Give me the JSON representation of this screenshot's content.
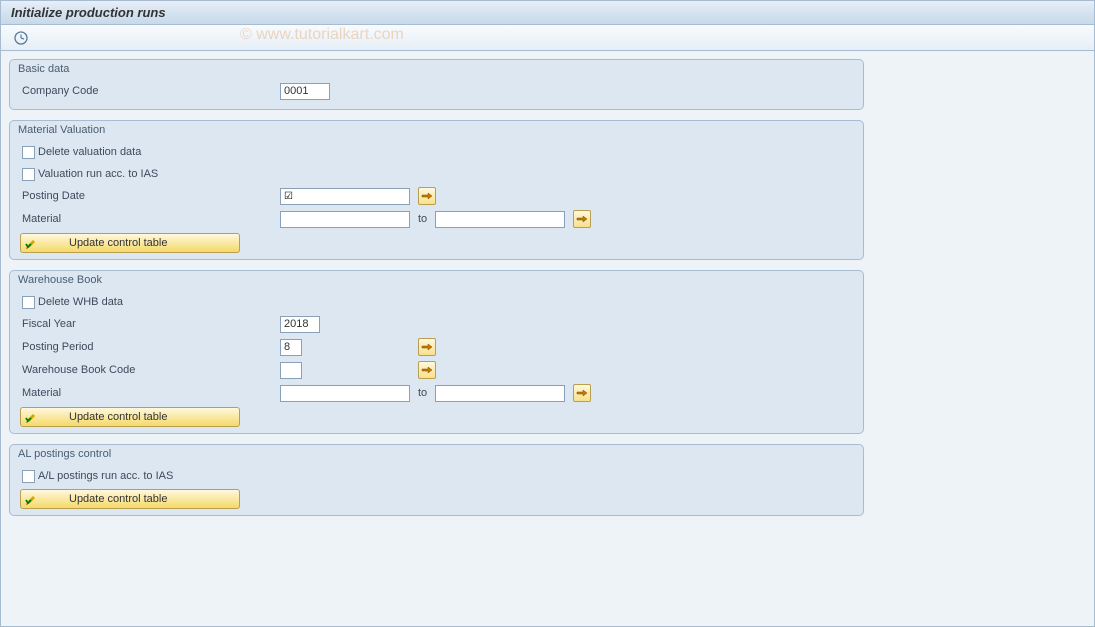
{
  "title": "Initialize production runs",
  "watermark": "© www.tutorialkart.com",
  "groups": {
    "basic": {
      "title": "Basic data",
      "company_code_label": "Company Code",
      "company_code_value": "0001"
    },
    "material_valuation": {
      "title": "Material Valuation",
      "delete_valuation_label": "Delete valuation data",
      "delete_valuation_checked": false,
      "valuation_ias_label": "Valuation run acc. to IAS",
      "valuation_ias_checked": false,
      "posting_date_label": "Posting Date",
      "posting_date_value": "",
      "material_label": "Material",
      "material_from": "",
      "material_to_label": "to",
      "material_to": "",
      "update_btn_label": "Update control table"
    },
    "warehouse": {
      "title": "Warehouse Book",
      "delete_whb_label": "Delete WHB data",
      "delete_whb_checked": false,
      "fiscal_year_label": "Fiscal Year",
      "fiscal_year_value": "2018",
      "posting_period_label": "Posting Period",
      "posting_period_value": "8",
      "whb_code_label": "Warehouse Book Code",
      "whb_code_value": "",
      "material_label": "Material",
      "material_from": "",
      "material_to_label": "to",
      "material_to": "",
      "update_btn_label": "Update control table"
    },
    "al_postings": {
      "title": "AL postings control",
      "al_ias_label": "A/L postings run acc. to IAS",
      "al_ias_checked": false,
      "update_btn_label": "Update control table"
    }
  }
}
